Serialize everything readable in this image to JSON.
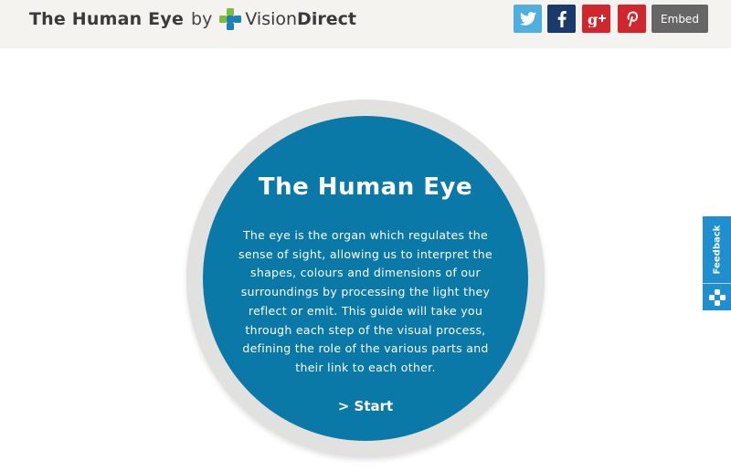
{
  "header": {
    "title": "The Human Eye",
    "by": "by",
    "brand_regular": "Vision",
    "brand_bold": "Direct",
    "share_icons": [
      "twitter-icon",
      "facebook-icon",
      "google-plus-icon",
      "pinterest-icon"
    ],
    "embed_label": "Embed"
  },
  "main": {
    "title": "The Human Eye",
    "body": "The eye is the organ which regulates the sense of sight, allowing us to interpret the shapes, colours and dimensions of our surroundings by processing the light they reflect or emit. This guide will take you through each step of the visual process, defining the role of the various parts and their link to each other.",
    "start_label": "> Start"
  },
  "feedback": {
    "label": "Feedback",
    "icon": "feedback-logo-icon"
  },
  "colors": {
    "header_bg": "#f4f3ef",
    "disc_blue": "#0a79a8",
    "ring_gray": "#e1e1df",
    "twitter": "#4fb0e0",
    "facebook": "#1a3a6b",
    "google_plus": "#d0262d",
    "pinterest": "#d0262d",
    "embed": "#666666",
    "feedback": "#1f8fd0",
    "logo_green": "#7cbd3a",
    "logo_blue": "#1f7fb8"
  }
}
